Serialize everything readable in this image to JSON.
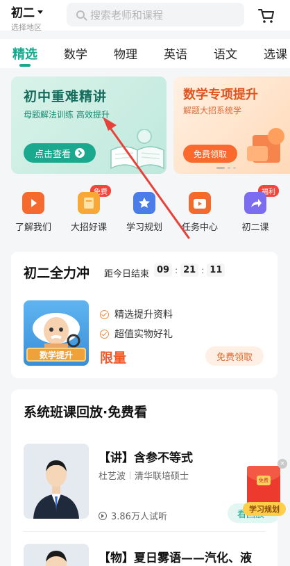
{
  "header": {
    "grade": "初二",
    "region_label": "选择地区",
    "search_placeholder": "搜索老师和课程"
  },
  "tabs": [
    {
      "label": "精选",
      "active": true
    },
    {
      "label": "数学",
      "active": false
    },
    {
      "label": "物理",
      "active": false
    },
    {
      "label": "英语",
      "active": false
    },
    {
      "label": "语文",
      "active": false
    },
    {
      "label": "选课",
      "active": false
    }
  ],
  "banners": {
    "main": {
      "title": "初中重难精讲",
      "subtitle": "母题解法训练 高效提升",
      "button": "点击查看"
    },
    "side": {
      "title": "数学专项提升",
      "subtitle": "解题大招系统学",
      "button": "免费领取"
    }
  },
  "quick_links": [
    {
      "label": "了解我们",
      "badge": "",
      "color": "#f56a2e",
      "icon": "play-video-icon"
    },
    {
      "label": "大招好课",
      "badge": "免费",
      "color": "#f7a836",
      "icon": "course-book-icon"
    },
    {
      "label": "学习规划",
      "badge": "",
      "color": "#4a7de8",
      "icon": "star-plan-icon"
    },
    {
      "label": "任务中心",
      "badge": "",
      "color": "#f36b2a",
      "icon": "tv-task-icon"
    },
    {
      "label": "初二课",
      "badge": "福利",
      "color": "#7b6cf0",
      "icon": "share-arrow-icon"
    }
  ],
  "promo_card": {
    "title": "初二全力冲",
    "countdown_label": "距今日结束",
    "timer": {
      "h": "09",
      "m": "21",
      "s": "11"
    },
    "thumb_label": "数学提升",
    "features": [
      "精选提升资料",
      "超值实物好礼"
    ],
    "limit_text": "限量",
    "button": "免费领取"
  },
  "course_section": {
    "title": "系统班课回放·免费看",
    "courses": [
      {
        "title": "【讲】含参不等式",
        "teacher": "杜艺波",
        "teacher_desc": "清华联培硕士",
        "views": "3.86万人试听",
        "button": "看回放"
      },
      {
        "title": "【物】夏日雾语——汽化、液"
      }
    ]
  },
  "floating_promo": {
    "coin_text": "免费",
    "label": "学习规划",
    "close": "×"
  },
  "colors": {
    "accent": "#1aa88f",
    "orange": "#f05a2a",
    "annotation_arrow": "#e8413a"
  }
}
